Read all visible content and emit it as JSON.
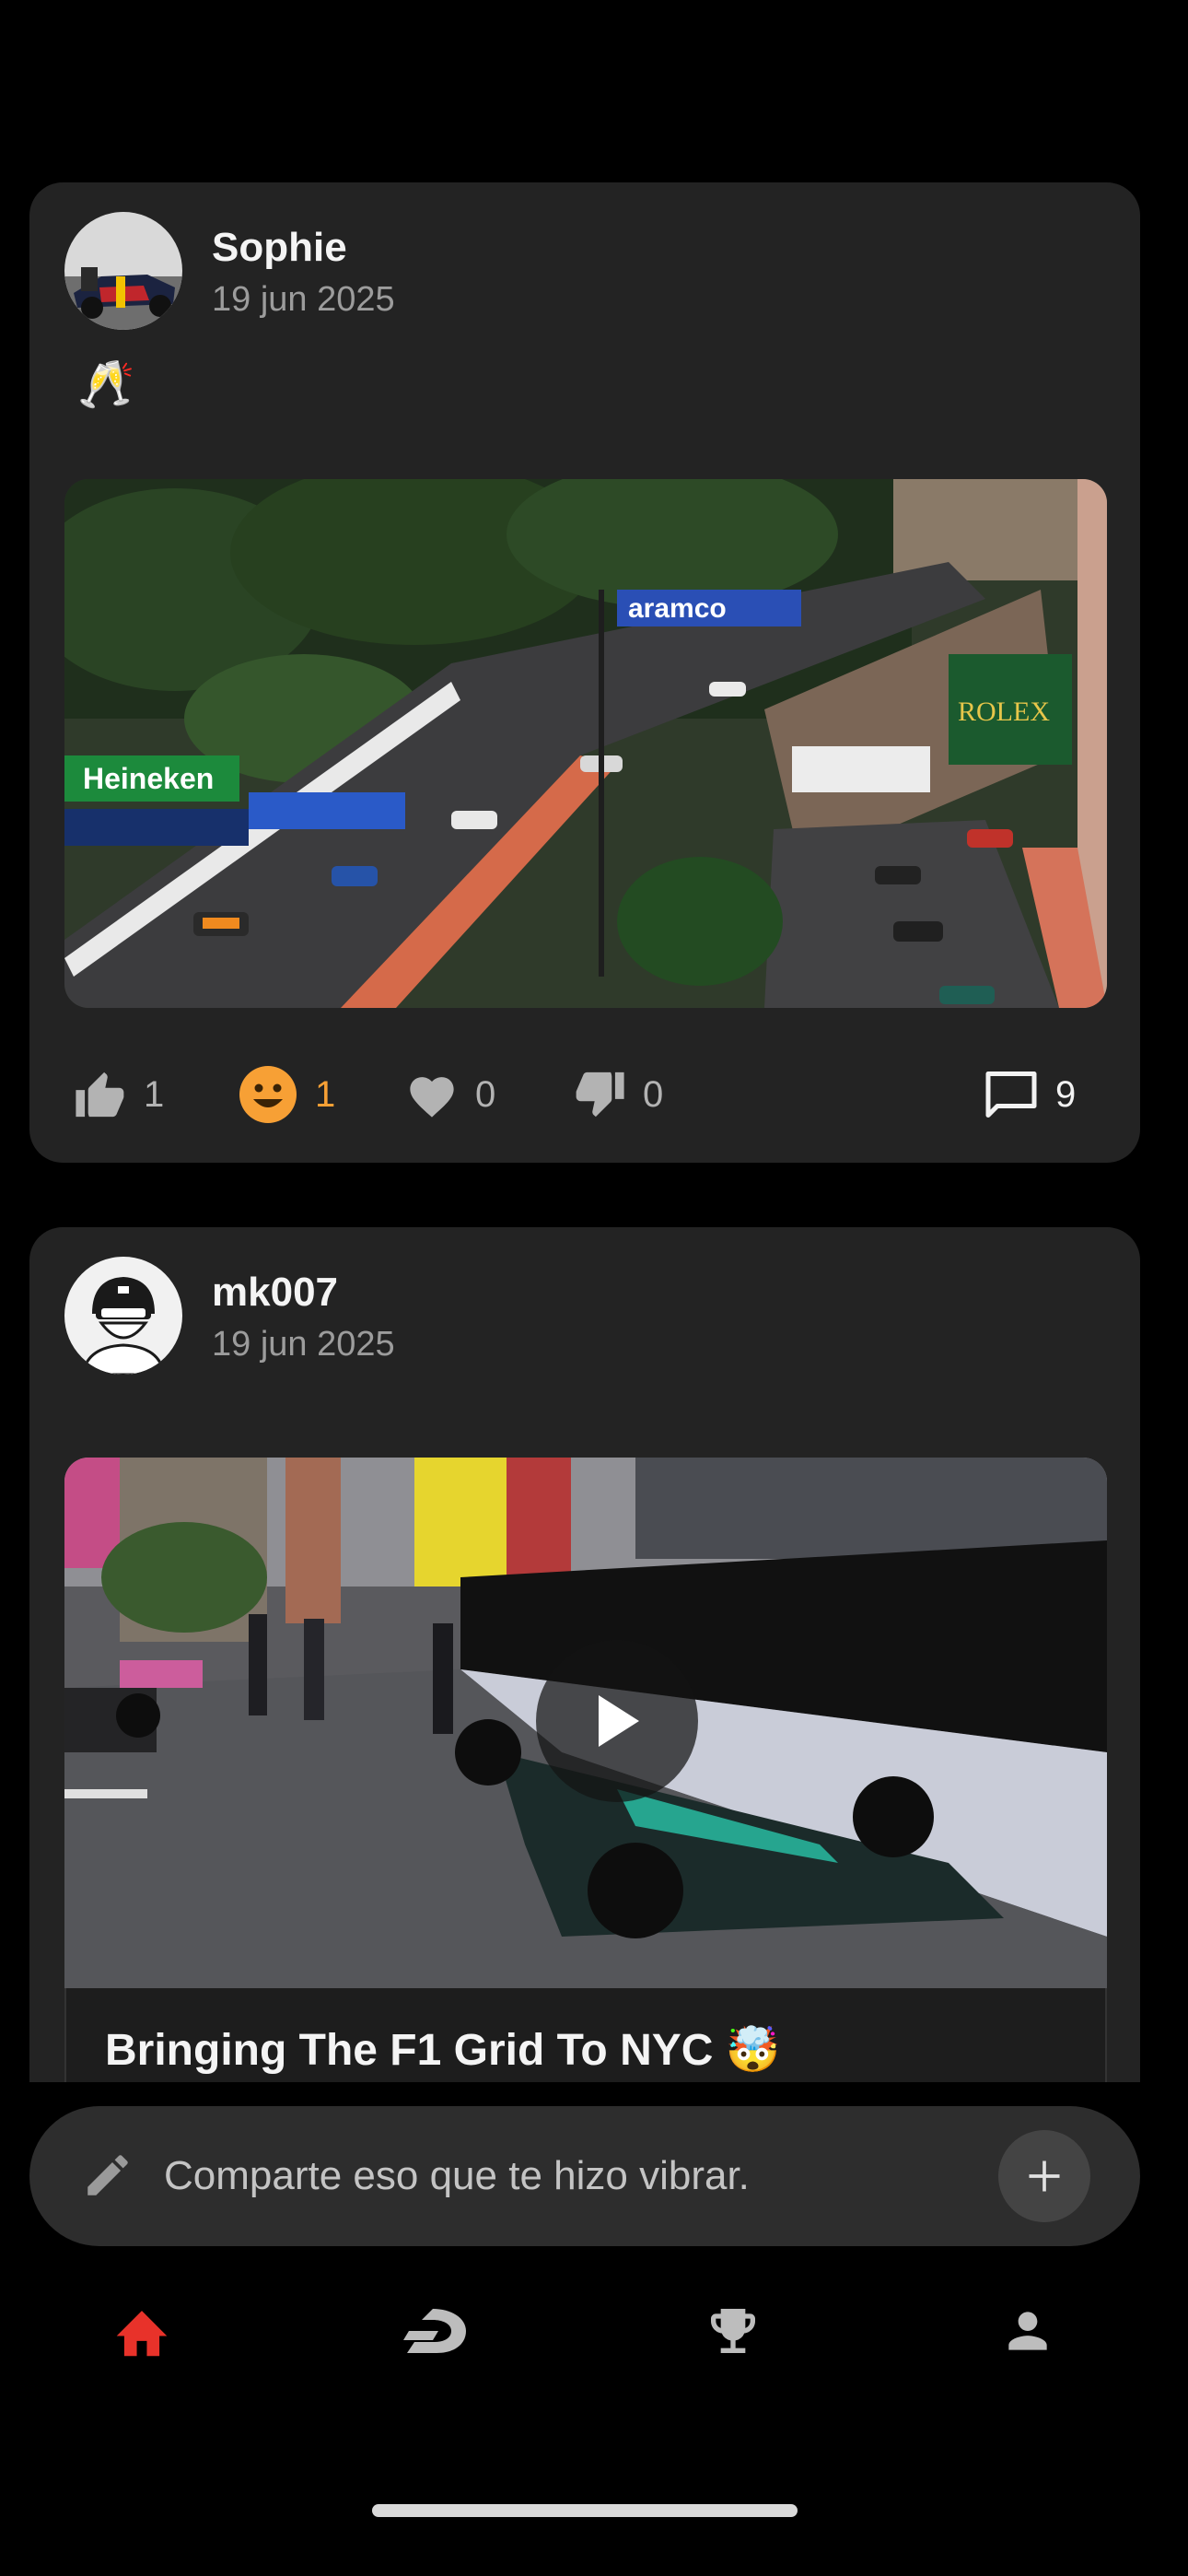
{
  "feed": {
    "posts": [
      {
        "author": "Sophie",
        "date": "19 jun 2025",
        "text": "🥂",
        "reactions": {
          "like": "1",
          "smile": "1",
          "heart": "0",
          "dislike": "0",
          "comments": "9"
        }
      },
      {
        "author": "mk007",
        "date": "19 jun 2025",
        "video_title": "Bringing The F1 Grid To NYC 🤯"
      }
    ]
  },
  "composer": {
    "placeholder": "Comparte eso que te hizo vibrar."
  },
  "tabbar": {
    "items": [
      "home-icon",
      "race-icon",
      "trophy-icon",
      "profile-icon"
    ],
    "active": "home-icon"
  },
  "colors": {
    "background": "#000000",
    "card": "#232323",
    "accent_active_tab": "#e8322a",
    "reaction_active": "#f7a035"
  }
}
